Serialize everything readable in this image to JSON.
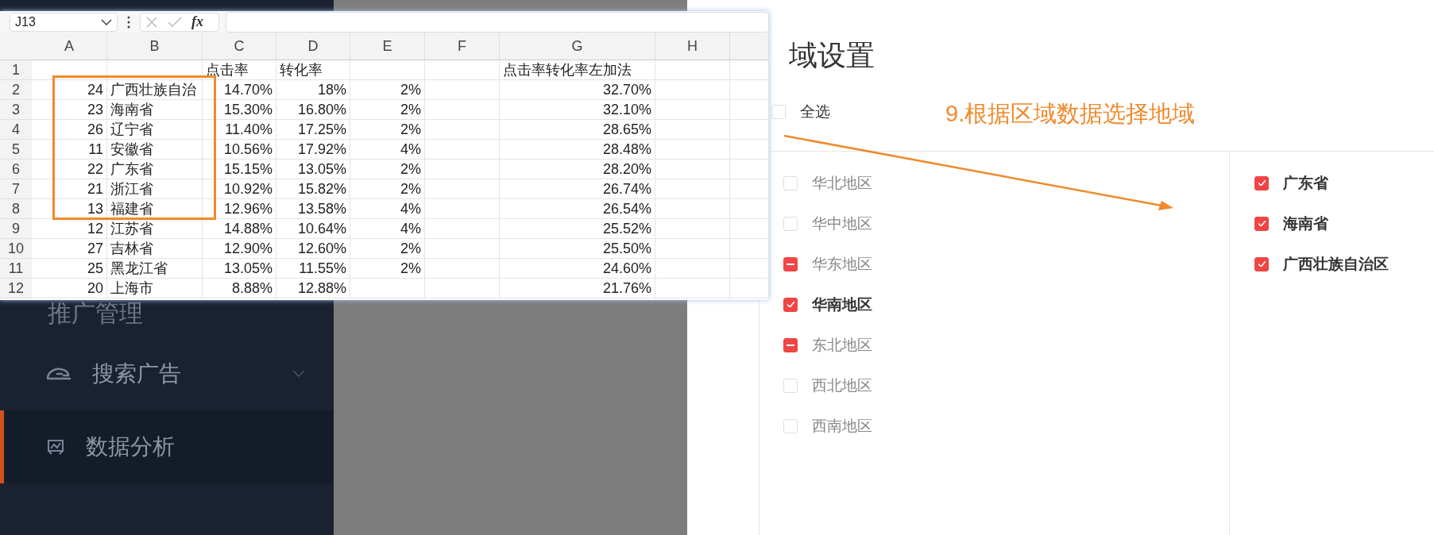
{
  "sidebar": {
    "items": [
      {
        "kind": "heading",
        "label": "推广管理",
        "selected": false
      },
      {
        "kind": "submenu",
        "label": "搜索广告",
        "selected": false
      },
      {
        "kind": "item",
        "label": "数据分析",
        "selected": true
      }
    ]
  },
  "drawer": {
    "title": "域设置",
    "select_all": {
      "label": "全选",
      "checked": false
    },
    "regions": [
      {
        "label": "华北地区",
        "checked": false,
        "indeterminate": false,
        "selected": false
      },
      {
        "label": "华中地区",
        "checked": false,
        "indeterminate": false,
        "selected": false
      },
      {
        "label": "华东地区",
        "checked": false,
        "indeterminate": true,
        "selected": false
      },
      {
        "label": "华南地区",
        "checked": true,
        "indeterminate": false,
        "selected": true
      },
      {
        "label": "东北地区",
        "checked": false,
        "indeterminate": true,
        "selected": false
      },
      {
        "label": "西北地区",
        "checked": false,
        "indeterminate": false,
        "selected": false
      },
      {
        "label": "西南地区",
        "checked": false,
        "indeterminate": false,
        "selected": false
      }
    ],
    "provinces": [
      {
        "label": "广东省",
        "checked": true
      },
      {
        "label": "海南省",
        "checked": true
      },
      {
        "label": "广西壮族自治区",
        "checked": true
      }
    ]
  },
  "annotation": {
    "text": "9.根据区域数据选择地域"
  },
  "spreadsheet": {
    "name_box": "J13",
    "function_label": "fx",
    "columns": [
      "A",
      "B",
      "C",
      "D",
      "E",
      "F",
      "G",
      "H"
    ],
    "rows": [
      {
        "num": "1",
        "cells": {
          "C": "点击率",
          "D": "转化率",
          "G": "点击率转化率左加法"
        }
      },
      {
        "num": "2",
        "cells": {
          "A": "24",
          "B": "广西壮族自治",
          "C": "14.70%",
          "D": "18%",
          "E": "2%",
          "G": "32.70%"
        }
      },
      {
        "num": "3",
        "cells": {
          "A": "23",
          "B": "海南省",
          "C": "15.30%",
          "D": "16.80%",
          "E": "2%",
          "G": "32.10%"
        }
      },
      {
        "num": "4",
        "cells": {
          "A": "26",
          "B": "辽宁省",
          "C": "11.40%",
          "D": "17.25%",
          "E": "2%",
          "G": "28.65%"
        }
      },
      {
        "num": "5",
        "cells": {
          "A": "11",
          "B": "安徽省",
          "C": "10.56%",
          "D": "17.92%",
          "E": "4%",
          "G": "28.48%"
        }
      },
      {
        "num": "6",
        "cells": {
          "A": "22",
          "B": "广东省",
          "C": "15.15%",
          "D": "13.05%",
          "E": "2%",
          "G": "28.20%"
        }
      },
      {
        "num": "7",
        "cells": {
          "A": "21",
          "B": "浙江省",
          "C": "10.92%",
          "D": "15.82%",
          "E": "2%",
          "G": "26.74%"
        }
      },
      {
        "num": "8",
        "cells": {
          "A": "13",
          "B": "福建省",
          "C": "12.96%",
          "D": "13.58%",
          "E": "4%",
          "G": "26.54%"
        }
      },
      {
        "num": "9",
        "cells": {
          "A": "12",
          "B": "江苏省",
          "C": "14.88%",
          "D": "10.64%",
          "E": "4%",
          "G": "25.52%"
        }
      },
      {
        "num": "10",
        "cells": {
          "A": "27",
          "B": "吉林省",
          "C": "12.90%",
          "D": "12.60%",
          "E": "2%",
          "G": "25.50%"
        }
      },
      {
        "num": "11",
        "cells": {
          "A": "25",
          "B": "黑龙江省",
          "C": "13.05%",
          "D": "11.55%",
          "E": "2%",
          "G": "24.60%"
        }
      },
      {
        "num": "12",
        "cells": {
          "A": "20",
          "B": "上海市",
          "C": "8.88%",
          "D": "12.88%",
          "G": "21.76%"
        }
      }
    ]
  }
}
